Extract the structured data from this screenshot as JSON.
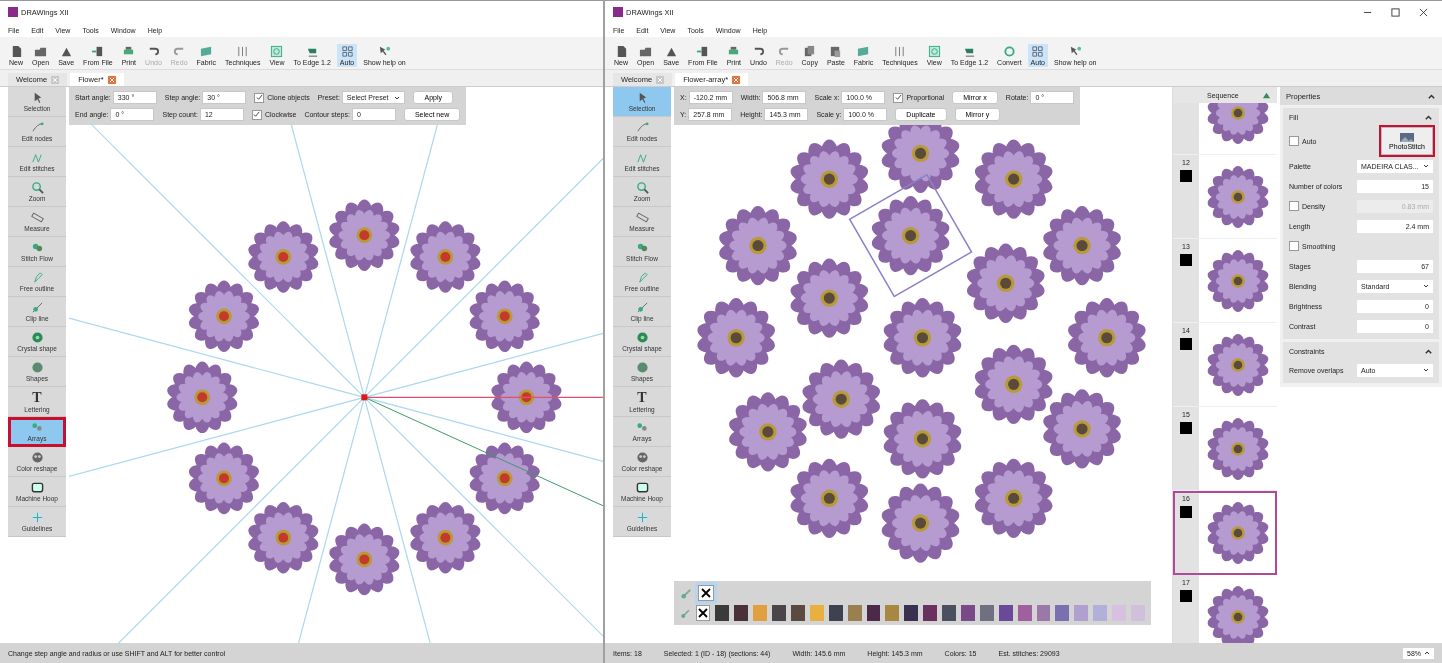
{
  "windows": [
    {
      "title": "DRAWings XII",
      "menu": [
        "File",
        "Edit",
        "View",
        "Tools",
        "Window",
        "Help"
      ],
      "toolbar": [
        {
          "label": "New",
          "kind": "page",
          "disabled": false,
          "selected": false
        },
        {
          "label": "Open",
          "kind": "folder",
          "disabled": false,
          "selected": false
        },
        {
          "label": "Save",
          "kind": "disk",
          "disabled": false,
          "selected": false
        },
        {
          "label": "From File",
          "kind": "import",
          "disabled": false,
          "selected": false
        },
        {
          "label": "Print",
          "kind": "printer",
          "disabled": false,
          "selected": false
        },
        {
          "label": "Undo",
          "kind": "undo",
          "disabled": true,
          "selected": false
        },
        {
          "label": "Redo",
          "kind": "redo",
          "disabled": true,
          "selected": false
        },
        {
          "label": "Fabric",
          "kind": "fabric",
          "disabled": false,
          "selected": false
        },
        {
          "label": "Techniques",
          "kind": "techniques",
          "disabled": false,
          "selected": false
        },
        {
          "label": "View",
          "kind": "view",
          "disabled": false,
          "selected": false
        },
        {
          "label": "To Edge 1.2",
          "kind": "edge",
          "disabled": false,
          "selected": false
        },
        {
          "label": "Auto",
          "kind": "auto",
          "disabled": false,
          "selected": true
        },
        {
          "label": "Show help on",
          "kind": "help",
          "disabled": false,
          "selected": false
        }
      ],
      "tabs": [
        {
          "label": "Welcome",
          "selected": false
        },
        {
          "label": "Flower*",
          "selected": true
        }
      ],
      "tools": [
        {
          "label": "Selection",
          "kind": "arrow",
          "selected": false,
          "highlighted": false
        },
        {
          "label": "Edit nodes",
          "kind": "nodes",
          "selected": false,
          "highlighted": false
        },
        {
          "label": "Edit stitches",
          "kind": "stitches",
          "selected": false,
          "highlighted": false
        },
        {
          "label": "Zoom",
          "kind": "magnifier",
          "selected": false,
          "highlighted": false
        },
        {
          "label": "Measure",
          "kind": "ruler",
          "selected": false,
          "highlighted": false
        },
        {
          "label": "Stitch Flow",
          "kind": "flow",
          "selected": false,
          "highlighted": false
        },
        {
          "label": "Free outline",
          "kind": "outline",
          "selected": false,
          "highlighted": false
        },
        {
          "label": "Clip line",
          "kind": "clip",
          "selected": false,
          "highlighted": false
        },
        {
          "label": "Crystal shape",
          "kind": "crystal",
          "selected": false,
          "highlighted": false
        },
        {
          "label": "Shapes",
          "kind": "shapes",
          "selected": false,
          "highlighted": false
        },
        {
          "label": "Lettering",
          "kind": "letter",
          "glyph": "T",
          "selected": false,
          "highlighted": false
        },
        {
          "label": "Arrays",
          "kind": "arrays",
          "selected": true,
          "highlighted": true
        },
        {
          "label": "Color reshape",
          "kind": "reshape",
          "selected": false,
          "highlighted": false
        },
        {
          "label": "Machine Hoop",
          "kind": "hoop",
          "selected": false,
          "highlighted": false
        },
        {
          "label": "Guidelines",
          "kind": "guides",
          "selected": false,
          "highlighted": false
        }
      ],
      "options": [
        [
          {
            "kind": "field",
            "label": "Start angle:",
            "value": "330 °"
          },
          {
            "kind": "field",
            "label": "Step angle:",
            "value": "30 °"
          },
          {
            "kind": "check",
            "label": "Clone objects",
            "checked": true
          },
          {
            "kind": "select",
            "label": "Preset:",
            "value": "Select Preset"
          },
          {
            "kind": "button",
            "label": "Apply"
          }
        ],
        [
          {
            "kind": "field",
            "label": "End angle:",
            "value": "0 °"
          },
          {
            "kind": "field",
            "label": "Step count:",
            "value": "12"
          },
          {
            "kind": "check",
            "label": "Clockwise",
            "checked": true
          },
          {
            "kind": "field",
            "label": "Contour steps:",
            "value": "0"
          },
          {
            "kind": "button",
            "label": "Select new"
          }
        ]
      ],
      "canvas": {
        "kind": "array"
      },
      "status": [
        "Change step angle and radius or use SHIFT and ALT for better control"
      ]
    },
    {
      "title": "DRAWings XII",
      "controls": true,
      "menu": [
        "File",
        "Edit",
        "View",
        "Tools",
        "Window",
        "Help"
      ],
      "toolbar": [
        {
          "label": "New",
          "kind": "page",
          "disabled": false,
          "selected": false
        },
        {
          "label": "Open",
          "kind": "folder",
          "disabled": false,
          "selected": false
        },
        {
          "label": "Save",
          "kind": "disk",
          "disabled": false,
          "selected": false
        },
        {
          "label": "From File",
          "kind": "import",
          "disabled": false,
          "selected": false
        },
        {
          "label": "Print",
          "kind": "printer",
          "disabled": false,
          "selected": false
        },
        {
          "label": "Undo",
          "kind": "undo",
          "disabled": false,
          "selected": false
        },
        {
          "label": "Redo",
          "kind": "redo",
          "disabled": true,
          "selected": false
        },
        {
          "label": "Copy",
          "kind": "copy",
          "disabled": false,
          "selected": false
        },
        {
          "label": "Paste",
          "kind": "paste",
          "disabled": false,
          "selected": false
        },
        {
          "label": "Fabric",
          "kind": "fabric",
          "disabled": false,
          "selected": false
        },
        {
          "label": "Techniques",
          "kind": "techniques",
          "disabled": false,
          "selected": false
        },
        {
          "label": "View",
          "kind": "view",
          "disabled": false,
          "selected": false
        },
        {
          "label": "To Edge 1.2",
          "kind": "edge",
          "disabled": false,
          "selected": false
        },
        {
          "label": "Convert",
          "kind": "convert",
          "disabled": false,
          "selected": false
        },
        {
          "label": "Auto",
          "kind": "auto",
          "disabled": false,
          "selected": true
        },
        {
          "label": "Show help on",
          "kind": "help",
          "disabled": false,
          "selected": false
        }
      ],
      "tabs": [
        {
          "label": "Welcome",
          "selected": false
        },
        {
          "label": "Flower-array*",
          "selected": true
        }
      ],
      "tools": [
        {
          "label": "Selection",
          "kind": "arrow",
          "selected": true,
          "highlighted": false
        },
        {
          "label": "Edit nodes",
          "kind": "nodes",
          "selected": false,
          "highlighted": false
        },
        {
          "label": "Edit stitches",
          "kind": "stitches",
          "selected": false,
          "highlighted": false
        },
        {
          "label": "Zoom",
          "kind": "magnifier",
          "selected": false,
          "highlighted": false
        },
        {
          "label": "Measure",
          "kind": "ruler",
          "selected": false,
          "highlighted": false
        },
        {
          "label": "Stitch Flow",
          "kind": "flow",
          "selected": false,
          "highlighted": false
        },
        {
          "label": "Free outline",
          "kind": "outline",
          "selected": false,
          "highlighted": false
        },
        {
          "label": "Clip line",
          "kind": "clip",
          "selected": false,
          "highlighted": false
        },
        {
          "label": "Crystal shape",
          "kind": "crystal",
          "selected": false,
          "highlighted": false
        },
        {
          "label": "Shapes",
          "kind": "shapes",
          "selected": false,
          "highlighted": false
        },
        {
          "label": "Lettering",
          "kind": "letter",
          "glyph": "T",
          "selected": false,
          "highlighted": false
        },
        {
          "label": "Arrays",
          "kind": "arrays",
          "selected": false,
          "highlighted": false
        },
        {
          "label": "Color reshape",
          "kind": "reshape",
          "selected": false,
          "highlighted": false
        },
        {
          "label": "Machine Hoop",
          "kind": "hoop",
          "selected": false,
          "highlighted": false
        },
        {
          "label": "Guidelines",
          "kind": "guides",
          "selected": false,
          "highlighted": false
        }
      ],
      "options": [
        [
          {
            "kind": "field",
            "label": "X:",
            "value": "-120.2 mm"
          },
          {
            "kind": "field",
            "label": "Width:",
            "value": "506.8 mm"
          },
          {
            "kind": "field",
            "label": "Scale x:",
            "value": "100.0 %"
          },
          {
            "kind": "check",
            "label": "Proportional",
            "checked": true
          },
          {
            "kind": "button",
            "label": "Mirror x"
          },
          {
            "kind": "field",
            "label": "Rotate:",
            "value": "0 °"
          }
        ],
        [
          {
            "kind": "field",
            "label": "Y:",
            "value": "257.8 mm"
          },
          {
            "kind": "field",
            "label": "Height:",
            "value": "145.3 mm"
          },
          {
            "kind": "field",
            "label": "Scale y:",
            "value": "100.0 %"
          },
          {
            "kind": "button",
            "label": "Duplicate"
          },
          {
            "kind": "button",
            "label": "Mirror y"
          }
        ]
      ],
      "canvas": {
        "kind": "layout"
      },
      "palette": [
        {
          "swatches": [
            {
              "kind": "none",
              "selected": true
            }
          ]
        },
        {
          "swatches": [
            {
              "kind": "none",
              "selected": false
            },
            {
              "kind": "color",
              "color": "#3b3b3d",
              "selected": false
            },
            {
              "kind": "color",
              "color": "#4a3038",
              "selected": false
            },
            {
              "kind": "color",
              "color": "#e0a040",
              "selected": false
            },
            {
              "kind": "color",
              "color": "#4b4448",
              "selected": false
            },
            {
              "kind": "color",
              "color": "#5a4a42",
              "selected": false
            },
            {
              "kind": "color",
              "color": "#e8b040",
              "selected": false
            },
            {
              "kind": "color",
              "color": "#3e4250",
              "selected": false
            },
            {
              "kind": "color",
              "color": "#9a8050",
              "selected": false
            },
            {
              "kind": "color",
              "color": "#4a2a48",
              "selected": false
            },
            {
              "kind": "color",
              "color": "#a88840",
              "selected": false
            },
            {
              "kind": "color",
              "color": "#3a3050",
              "selected": false
            },
            {
              "kind": "color",
              "color": "#6a3060",
              "selected": false
            },
            {
              "kind": "color",
              "color": "#4a5060",
              "selected": false
            },
            {
              "kind": "color",
              "color": "#7a4a88",
              "selected": false
            },
            {
              "kind": "color",
              "color": "#707080",
              "selected": false
            },
            {
              "kind": "color",
              "color": "#6a4a98",
              "selected": false
            },
            {
              "kind": "color",
              "color": "#a060a0",
              "selected": false
            },
            {
              "kind": "color",
              "color": "#9a78a8",
              "selected": false
            },
            {
              "kind": "color",
              "color": "#7a70b0",
              "selected": false
            },
            {
              "kind": "color",
              "color": "#b0a0d0",
              "selected": false
            },
            {
              "kind": "color",
              "color": "#b0b0d8",
              "selected": false
            },
            {
              "kind": "color",
              "color": "#d8c0e0",
              "selected": false
            },
            {
              "kind": "color",
              "color": "#d0c0dc",
              "selected": false
            }
          ]
        }
      ],
      "sequence": {
        "title": "Sequence",
        "items": [
          {
            "selected": false
          },
          {
            "number": "12",
            "selected": false
          },
          {
            "number": "13",
            "selected": false
          },
          {
            "number": "14",
            "selected": false
          },
          {
            "number": "15",
            "selected": false
          },
          {
            "number": "16",
            "selected": true
          },
          {
            "number": "17",
            "selected": false
          }
        ]
      },
      "properties": {
        "title": "Properties",
        "expanded": true,
        "sections": [
          {
            "title": "Fill",
            "expanded": true,
            "rows": [
              {
                "kind": "check",
                "label": "Auto",
                "checked": false,
                "button": {
                  "label": "PhotoStitch",
                  "highlighted": true
                }
              },
              {
                "kind": "select",
                "label": "Palette",
                "value": "MADEIRA CLAS..."
              },
              {
                "kind": "field",
                "label": "Number of colors",
                "value": "15"
              },
              {
                "kind": "check",
                "label": "Density",
                "checked": false,
                "value": "0.83 mm"
              },
              {
                "kind": "field",
                "label": "Length",
                "value": "2.4 mm"
              },
              {
                "kind": "check",
                "label": "Smoothing",
                "checked": false
              },
              {
                "kind": "field",
                "label": "Stages",
                "value": "67"
              },
              {
                "kind": "select",
                "label": "Blending",
                "value": "Standard"
              },
              {
                "kind": "field",
                "label": "Brightness",
                "value": "0"
              },
              {
                "kind": "field",
                "label": "Contrast",
                "value": "0"
              }
            ]
          },
          {
            "title": "Constraints",
            "expanded": true,
            "rows": [
              {
                "kind": "select",
                "label": "Remove overlaps",
                "value": "Auto"
              }
            ]
          }
        ]
      },
      "status": [
        "Items: 18",
        "Selected: 1 (ID - 18) (sections: 44)",
        "Width: 145.6 mm",
        "Height: 145.3 mm",
        "Colors: 15",
        "Est. stitches: 29093"
      ],
      "zoom": "58%"
    }
  ]
}
